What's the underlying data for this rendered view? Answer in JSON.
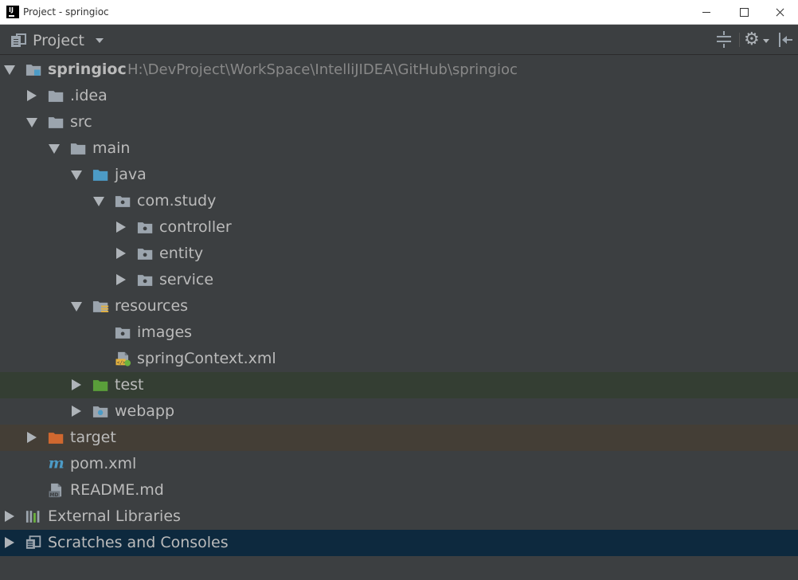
{
  "window": {
    "title": "Project - springioc"
  },
  "toolbar": {
    "view_title": "Project"
  },
  "tree": [
    {
      "label": "springioc",
      "path": "H:\\DevProject\\WorkSpace\\IntelliJIDEA\\GitHub\\springioc",
      "icon": "module-folder-icon",
      "expanded": true
    },
    {
      "label": ".idea",
      "icon": "folder-icon",
      "expanded": false
    },
    {
      "label": "src",
      "icon": "folder-icon",
      "expanded": true
    },
    {
      "label": "main",
      "icon": "folder-icon",
      "expanded": true
    },
    {
      "label": "java",
      "icon": "source-root-folder-icon",
      "expanded": true
    },
    {
      "label": "com.study",
      "icon": "package-icon",
      "expanded": true
    },
    {
      "label": "controller",
      "icon": "package-icon",
      "expanded": false
    },
    {
      "label": "entity",
      "icon": "package-icon",
      "expanded": false
    },
    {
      "label": "service",
      "icon": "package-icon",
      "expanded": false
    },
    {
      "label": "resources",
      "icon": "resources-root-folder-icon",
      "expanded": true
    },
    {
      "label": "images",
      "icon": "package-icon"
    },
    {
      "label": "springContext.xml",
      "icon": "spring-xml-file-icon"
    },
    {
      "label": "test",
      "icon": "test-root-folder-icon",
      "expanded": false
    },
    {
      "label": "webapp",
      "icon": "web-folder-icon",
      "expanded": false
    },
    {
      "label": "target",
      "icon": "excluded-folder-icon",
      "expanded": false
    },
    {
      "label": "pom.xml",
      "icon": "maven-file-icon"
    },
    {
      "label": "README.md",
      "icon": "markdown-file-icon"
    },
    {
      "label": "External Libraries",
      "icon": "libraries-icon",
      "expanded": false
    },
    {
      "label": "Scratches and Consoles",
      "icon": "scratches-icon",
      "expanded": false
    }
  ],
  "colors": {
    "background": "#3c3f41",
    "text": "#bbbbbb",
    "path_text": "#888888",
    "folder": "#9ba4ad",
    "source_folder": "#4c9bc6",
    "test_folder": "#5a9e3a",
    "excluded_folder": "#d0682f",
    "selection": "#0d293e"
  }
}
